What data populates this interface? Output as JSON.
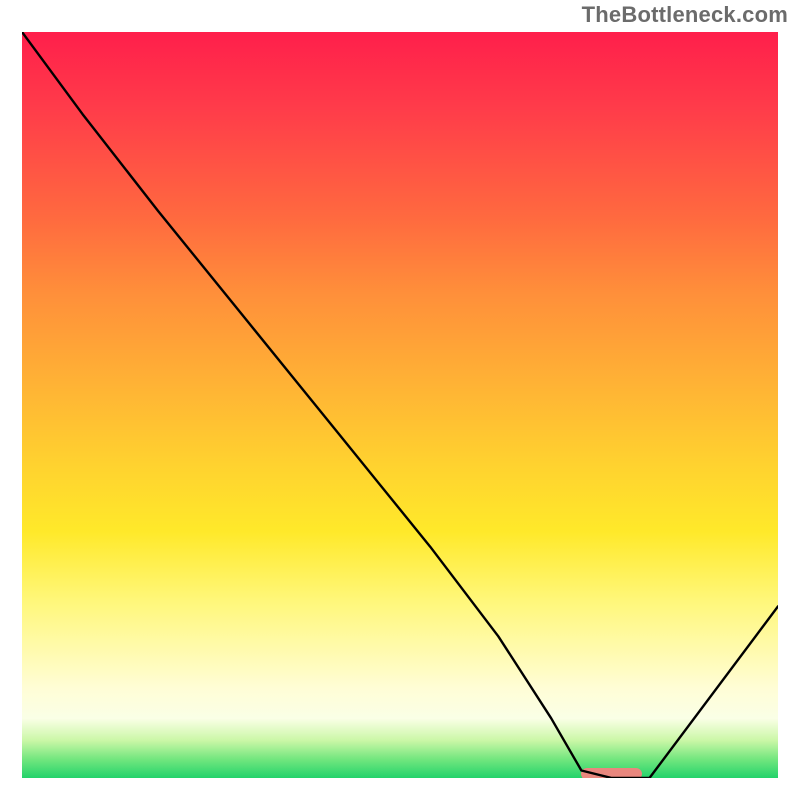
{
  "watermark": "TheBottleneck.com",
  "chart_data": {
    "type": "line",
    "title": "",
    "xlabel": "",
    "ylabel": "",
    "xlim": [
      0,
      100
    ],
    "ylim": [
      0,
      100
    ],
    "grid": false,
    "legend": false,
    "note": "Unlabeled curve over red→green vertical gradient; x and y in percent of plot area. Minimum plateau near x≈78, y≈0.",
    "series": [
      {
        "name": "curve",
        "x": [
          0,
          8,
          18,
          30,
          42,
          54,
          63,
          70,
          74,
          78,
          83,
          100
        ],
        "y": [
          100,
          89,
          76,
          61,
          46,
          31,
          19,
          8,
          1,
          0,
          0,
          23
        ]
      }
    ],
    "marker": {
      "name": "highlight-segment",
      "x_start": 74,
      "x_end": 82,
      "y": 0,
      "color": "#e9877e"
    },
    "gradient_stops": [
      {
        "pos": 0,
        "color": "#ff1f4b"
      },
      {
        "pos": 25,
        "color": "#ff6a3f"
      },
      {
        "pos": 50,
        "color": "#ffc531"
      },
      {
        "pos": 75,
        "color": "#fff778"
      },
      {
        "pos": 95,
        "color": "#caf7a6"
      },
      {
        "pos": 100,
        "color": "#23d36b"
      }
    ]
  }
}
